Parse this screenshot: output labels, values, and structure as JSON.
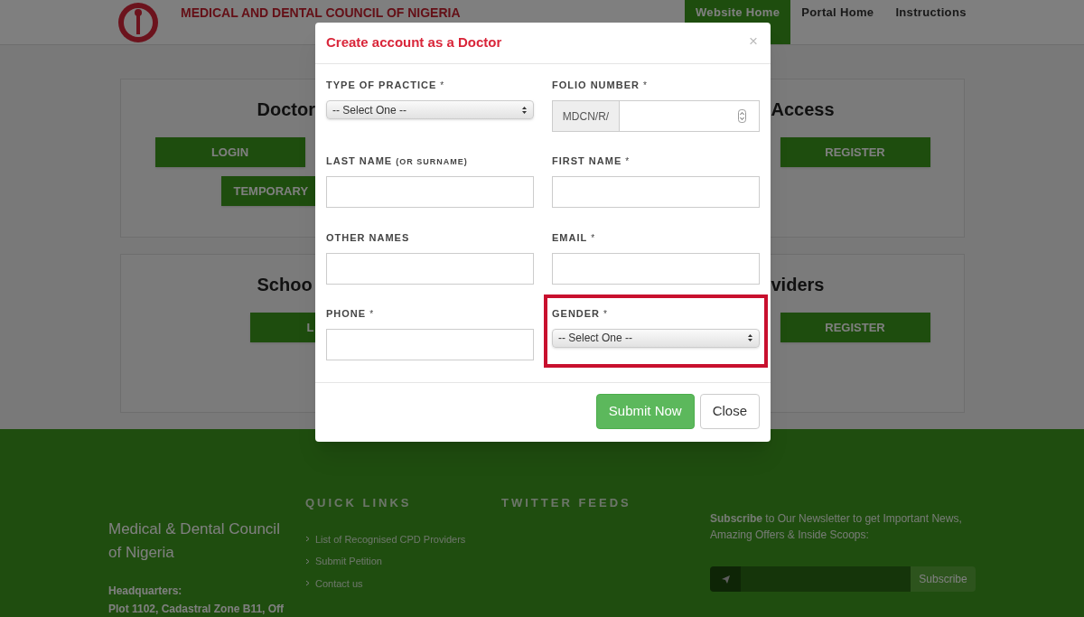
{
  "header": {
    "title": "MEDICAL AND DENTAL COUNCIL OF NIGERIA",
    "nav": [
      {
        "label": "Website Home",
        "selected": true
      },
      {
        "label": "Portal Home",
        "selected": false
      },
      {
        "label": "Instructions",
        "selected": false
      }
    ]
  },
  "cards": [
    {
      "left_title": "Doctor",
      "right_title": "Access",
      "left_buttons": [
        "LOGIN",
        "TEMPORARY"
      ],
      "right_buttons": [
        "REGISTER"
      ]
    },
    {
      "left_title": "Schoo",
      "right_title": "viders",
      "left_buttons": [
        "L"
      ],
      "right_buttons": [
        "REGISTER"
      ]
    }
  ],
  "modal": {
    "title": "Create account as a Doctor",
    "close": "×",
    "fields": [
      {
        "kind": "select",
        "label": "TYPE OF PRACTICE",
        "required_mark": "*",
        "value": "-- Select One --",
        "highlighted": false
      },
      {
        "kind": "prefixed",
        "label": "FOLIO NUMBER",
        "required_mark": "*",
        "prefix": "MDCN/R/",
        "highlighted": false
      },
      {
        "kind": "text",
        "label": "LAST NAME",
        "note": "(OR SURNAME)",
        "highlighted": false
      },
      {
        "kind": "text",
        "label": "FIRST NAME",
        "required_mark": "*",
        "highlighted": false
      },
      {
        "kind": "text",
        "label": "OTHER NAMES",
        "highlighted": false
      },
      {
        "kind": "text",
        "label": "EMAIL",
        "required_mark": "*",
        "highlighted": false
      },
      {
        "kind": "text",
        "label": "PHONE",
        "required_mark": "*",
        "highlighted": false
      },
      {
        "kind": "select",
        "label": "GENDER",
        "required_mark": "*",
        "value": "-- Select One --",
        "highlighted": true
      }
    ],
    "buttons": [
      {
        "label": "Submit Now",
        "kind": "primary"
      },
      {
        "label": "Close",
        "kind": "default"
      }
    ]
  },
  "footer": {
    "org_name": "Medical & Dental Council of Nigeria",
    "hq_label": "Headquarters:",
    "hq_address": "Plot 1102, Cadastral Zone B11, Off",
    "quick_links_title": "QUICK LINKS",
    "quick_links": [
      "List of Recognised CPD Providers",
      "Submit Petition",
      "Contact us"
    ],
    "twitter_title": "TWITTER FEEDS",
    "newsletter_text": "**Subscribe** to Our Newsletter to get Important News, Amazing Offers & Inside Scoops:",
    "subscribe_button": "Subscribe"
  }
}
